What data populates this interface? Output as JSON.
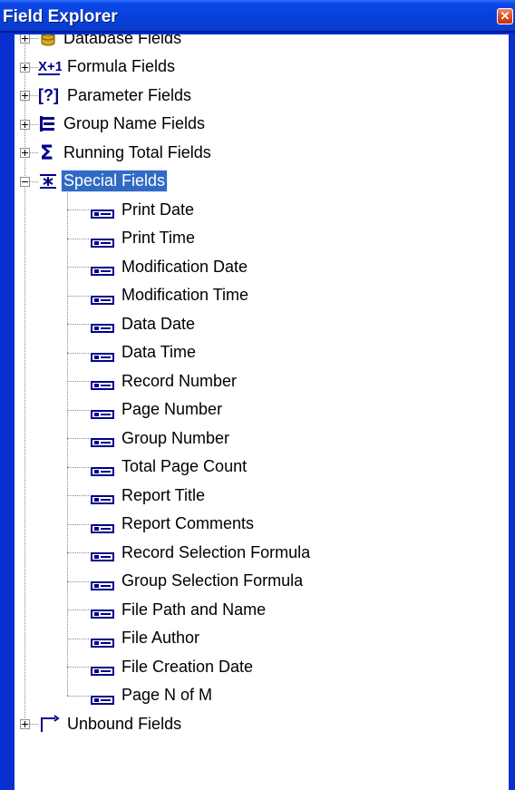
{
  "window": {
    "title": "Field Explorer",
    "close_label": "✕"
  },
  "tree": {
    "top_items": [
      {
        "label": "Database Fields",
        "icon": "database-icon",
        "expanded": false
      },
      {
        "label": "Formula Fields",
        "icon": "formula-icon",
        "expanded": false
      },
      {
        "label": "Parameter Fields",
        "icon": "parameter-icon",
        "expanded": false
      },
      {
        "label": "Group Name Fields",
        "icon": "group-name-icon",
        "expanded": false
      },
      {
        "label": "Running Total Fields",
        "icon": "sigma-icon",
        "expanded": false
      },
      {
        "label": "Special Fields",
        "icon": "special-fields-icon",
        "expanded": true,
        "selected": true
      }
    ],
    "special_fields": [
      "Print Date",
      "Print Time",
      "Modification Date",
      "Modification Time",
      "Data Date",
      "Data Time",
      "Record Number",
      "Page Number",
      "Group Number",
      "Total Page Count",
      "Report Title",
      "Report Comments",
      "Record Selection Formula",
      "Group Selection Formula",
      "File Path and Name",
      "File Author",
      "File Creation Date",
      "Page N of M"
    ],
    "bottom_item": {
      "label": "Unbound Fields",
      "icon": "unbound-icon",
      "expanded": false
    }
  },
  "colors": {
    "titlebar": "#0840d8",
    "selection": "#316ac5",
    "frame": "#0a2fcf"
  }
}
